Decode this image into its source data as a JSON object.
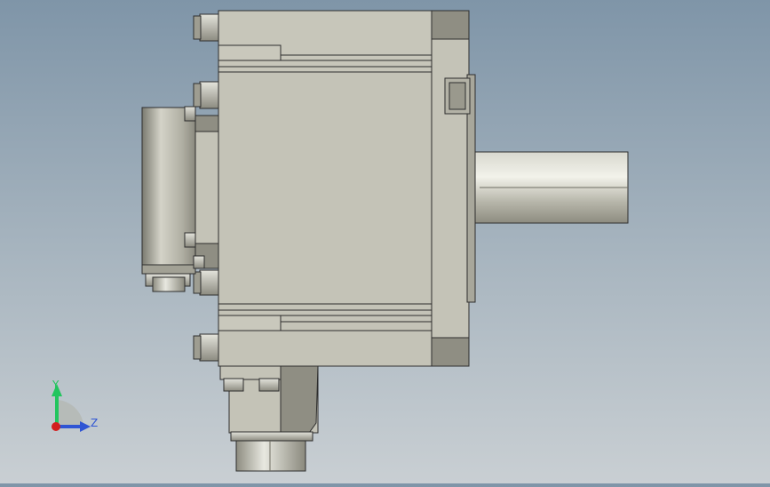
{
  "viewport": {
    "background_top": "#7f95a8",
    "background_bottom": "#c9cfd3"
  },
  "model": {
    "body_color": "#c4c3b7",
    "edge_color": "#2e2e2e",
    "shaft_color": "#a9a89c",
    "encoder_color": "#9d9c90"
  },
  "triad": {
    "y_label": "Y",
    "z_label": "Z",
    "y_color": "#22c55e",
    "z_color": "#2f55d4",
    "x_color": "#d31e1e"
  }
}
